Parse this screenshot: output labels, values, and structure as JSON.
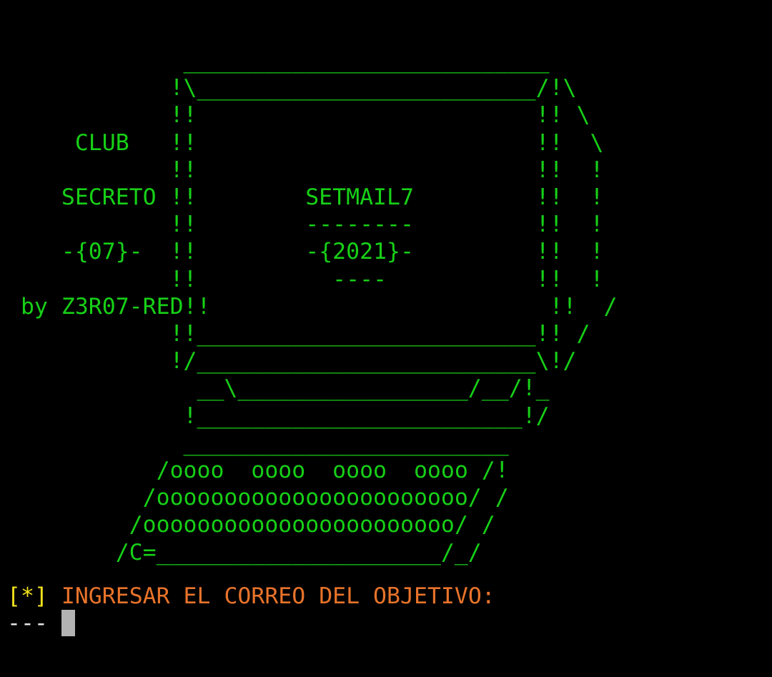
{
  "colors": {
    "background": "#000000",
    "banner_text": "#17d017",
    "prompt_bracket": "#f2e21b",
    "prompt_text": "#e8732a",
    "input_text": "#e6e6e6",
    "cursor": "#b3b3b3"
  },
  "banner": {
    "lines": [
      "             ___________________________",
      "            !\\_________________________/!\\",
      "            !!                         !! \\",
      "     CLUB   !!                         !!  \\",
      "            !!                         !!  !",
      "    SECRETO !!        SETMAIL7         !!  !",
      "            !!        --------         !!  !",
      "    -{07}-  !!        -{2021}-         !!  !",
      "            !!          ----           !!  !",
      " by Z3R07-RED!!                         !!  /",
      "            !!_________________________!! /",
      "            !/_________________________\\!/",
      "              __\\_________________/__/!_",
      "             !________________________!/",
      "             ________________________",
      "           /oooo  oooo  oooo  oooo /!",
      "          /ooooooooooooooooooooooo/ /",
      "         /ooooooooooooooooooooooo/ /",
      "        /C=_____________________/_/"
    ]
  },
  "prompt": {
    "marker": "[*]",
    "label": "INGRESAR EL CORREO DEL OBJETIVO:"
  },
  "input": {
    "prefix": "---",
    "value": ""
  }
}
